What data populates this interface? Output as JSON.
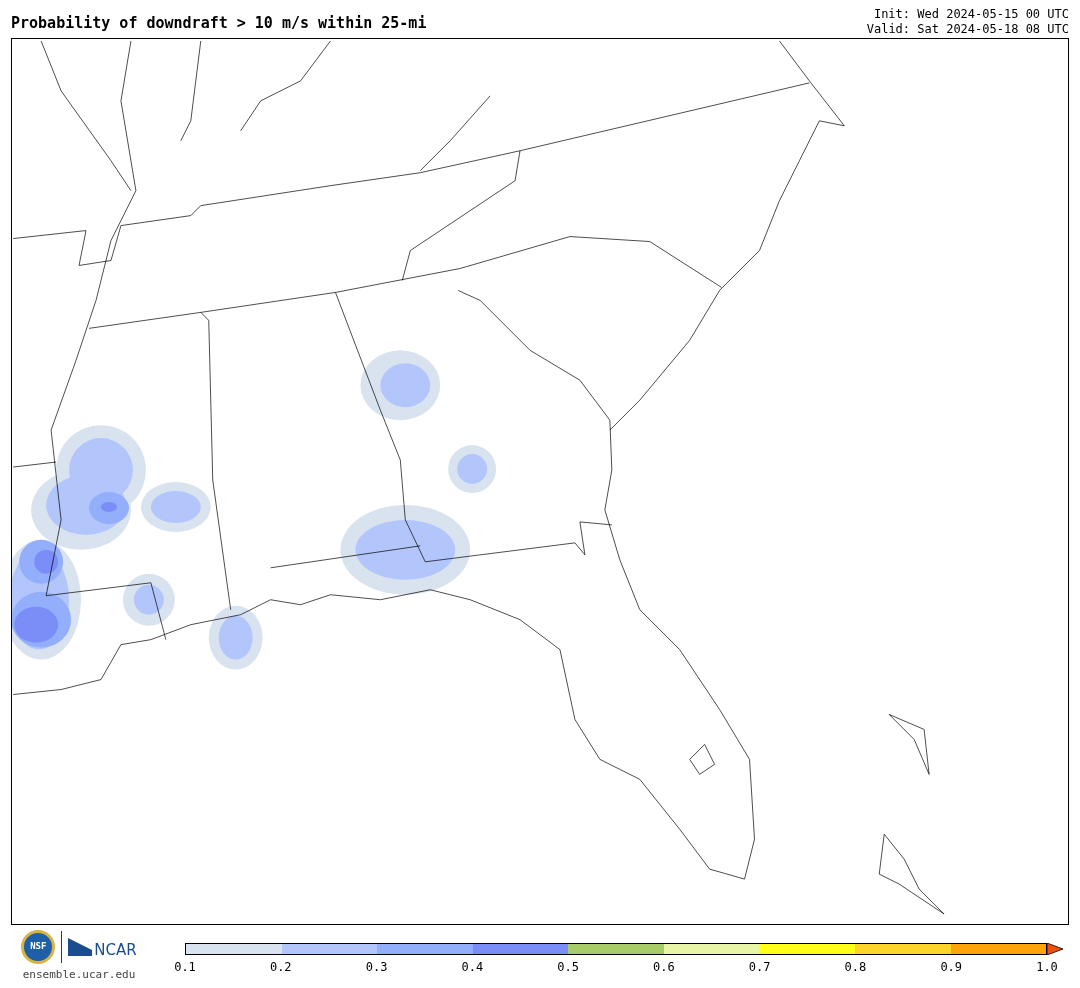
{
  "title": "Probability of downdraft > 10 m/s within 25-mi",
  "init": "Init: Wed 2024-05-15 00 UTC",
  "valid": "Valid: Sat 2024-05-18 08 UTC",
  "logos": {
    "nsf": "NSF",
    "ncar": "NCAR",
    "site": "ensemble.ucar.edu"
  },
  "colorbar": {
    "bins": [
      {
        "color": "#d9e3ef"
      },
      {
        "color": "#b3c6fb"
      },
      {
        "color": "#93aefa"
      },
      {
        "color": "#7b8ef8"
      },
      {
        "color": "#a8cc6a"
      },
      {
        "color": "#e8f5a6"
      },
      {
        "color": "#ffff1a"
      },
      {
        "color": "#fed42a"
      },
      {
        "color": "#ffa30a"
      }
    ],
    "extend": {
      "color": "#f04f0c"
    },
    "ticks": [
      "0.1",
      "0.2",
      "0.3",
      "0.4",
      "0.5",
      "0.6",
      "0.7",
      "0.8",
      "0.9",
      "1.0"
    ]
  }
}
